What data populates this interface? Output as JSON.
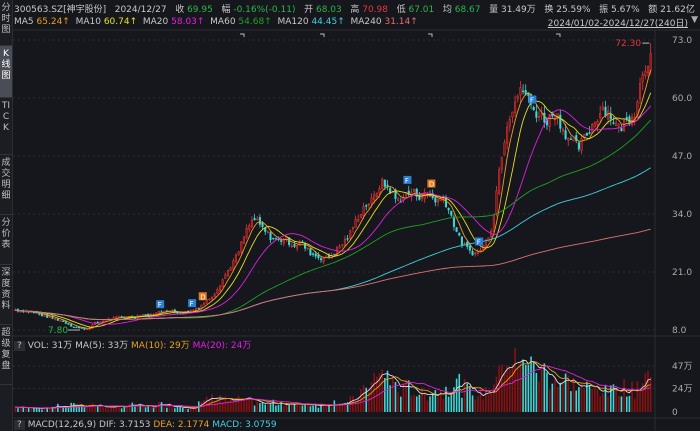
{
  "sidebar": {
    "items": [
      {
        "label": "分时图"
      },
      {
        "label": "K线图"
      },
      {
        "label": "TICK"
      },
      {
        "label": "成交明细"
      },
      {
        "label": "分价表"
      },
      {
        "label": "深度资料"
      },
      {
        "label": "超级复盘"
      }
    ],
    "active": 1
  },
  "header": {
    "code": "300563.SZ[神宇股份]",
    "date": "2024/12/27",
    "close_label": "收",
    "close": "69.95",
    "chg_label": "幅",
    "chg": "-0.16%(-0.11)",
    "open_label": "开",
    "open": "68.03",
    "high_label": "高",
    "high": "70.98",
    "low_label": "低",
    "low": "67.01",
    "avg_label": "均",
    "avg": "68.67",
    "vol_label": "量",
    "vol": "31.49万",
    "turn_label": "换",
    "turn": "25.59%",
    "amp_label": "振",
    "amp": "5.67%",
    "amt_label": "额",
    "amt": "21.62亿"
  },
  "ma_legend": [
    {
      "name": "MA5",
      "value": "65.24↑",
      "color": "#e8a020"
    },
    {
      "name": "MA10",
      "value": "60.74↑",
      "color": "#e8e020"
    },
    {
      "name": "MA20",
      "value": "58.03↑",
      "color": "#e020e0"
    },
    {
      "name": "MA60",
      "value": "54.68↑",
      "color": "#20a020"
    },
    {
      "name": "MA120",
      "value": "44.45↑",
      "color": "#40d0e0"
    },
    {
      "name": "MA240",
      "value": "31.14↑",
      "color": "#e07070"
    }
  ],
  "date_range": "2024/01/02-2024/12/27(240日)",
  "volume_legend": {
    "help": "?",
    "vol": "VOL: 31万",
    "ma5": "MA(5): 33万",
    "ma10": "MA(10): 29万",
    "ma20": "MA(20): 24万"
  },
  "macd_legend": {
    "help": "?",
    "name": "MACD(12,26,9)",
    "dif": "DIF: 3.7153",
    "dea": "DEA: 2.1774",
    "macd": "MACD: 3.0759"
  },
  "colors": {
    "up": "#e23b3b",
    "up_fill": "#8b1010",
    "down": "#3fd6d6",
    "bg": "#15171c"
  },
  "chart_data": {
    "type": "candlestick",
    "price_ticks": [
      "73.0",
      "60.0",
      "47.0",
      "34.0",
      "21.0",
      "8.0"
    ],
    "price_range": [
      8,
      73
    ],
    "volume_ticks": [
      "47万",
      "24万",
      "0"
    ],
    "volume_range": [
      0,
      47
    ],
    "max_label": "72.30",
    "min_label": "7.80",
    "closes": [
      12.5,
      12.3,
      12,
      11.5,
      11,
      10.5,
      10,
      9,
      8.5,
      8.2,
      9.5,
      10,
      10.5,
      10.8,
      11,
      11,
      11.5,
      11.2,
      12,
      12.5,
      12,
      11.8,
      12.2,
      13,
      14.5,
      16,
      19,
      22,
      25,
      30,
      33,
      31,
      29,
      28,
      28.5,
      27,
      27.5,
      25.5,
      24.5,
      24,
      25,
      27,
      29,
      33,
      36,
      37,
      41,
      40,
      37,
      38,
      39,
      38,
      38.5,
      37,
      37.5,
      33,
      28,
      26,
      25,
      27,
      31,
      45,
      55,
      60,
      62,
      58,
      56,
      55,
      57,
      53,
      50,
      49,
      52,
      55,
      58,
      56,
      53,
      55,
      57,
      66,
      69.95
    ],
    "volumes": [
      5,
      4,
      5,
      4,
      5,
      6,
      5,
      7,
      6,
      8,
      6,
      5,
      5,
      6,
      7,
      6,
      5,
      6,
      8,
      7,
      6,
      5,
      6,
      9,
      14,
      16,
      12,
      10,
      12,
      11,
      10,
      8,
      9,
      10,
      8,
      7,
      9,
      8,
      7,
      9,
      10,
      9,
      12,
      20,
      28,
      34,
      40,
      30,
      22,
      25,
      20,
      18,
      22,
      20,
      26,
      30,
      24,
      20,
      18,
      22,
      35,
      55,
      52,
      45,
      60,
      40,
      42,
      35,
      30,
      32,
      28,
      25,
      22,
      24,
      20,
      24,
      26,
      22,
      30,
      40,
      31
    ],
    "markers": [
      {
        "type": "F",
        "index": 55
      },
      {
        "type": "F",
        "index": 67
      },
      {
        "type": "D",
        "index": 71
      },
      {
        "type": "F",
        "index": 148
      },
      {
        "type": "F",
        "index": 175
      },
      {
        "type": "D",
        "index": 157
      },
      {
        "type": "F",
        "index": 195
      }
    ]
  }
}
